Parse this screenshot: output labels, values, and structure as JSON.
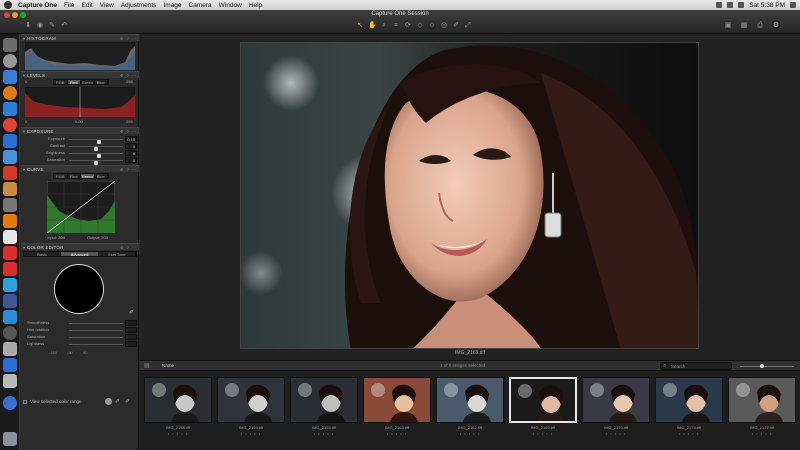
{
  "menubar": {
    "items": [
      "Capture One",
      "File",
      "Edit",
      "View",
      "Adjustments",
      "Image",
      "Camera",
      "Window",
      "Help"
    ],
    "clock": "Sat 5:38 PM"
  },
  "window": {
    "title": "Capture One Session"
  },
  "panel": {
    "histogram_title": "HISTOGRAM",
    "levels": {
      "title": "LEVELS",
      "channels": [
        "RGB",
        "Red",
        "Green",
        "Blue"
      ],
      "selected_channel": "Red",
      "low": "0",
      "mid": "0.00",
      "high": "255",
      "top_high": "255"
    },
    "exposure": {
      "title": "EXPOSURE",
      "rows": [
        {
          "label": "Exposure",
          "value": "0.15",
          "pos": 0.55
        },
        {
          "label": "Contrast",
          "value": "0",
          "pos": 0.5
        },
        {
          "label": "Brightness",
          "value": "8",
          "pos": 0.56
        },
        {
          "label": "Saturation",
          "value": "0",
          "pos": 0.5
        }
      ]
    },
    "curve": {
      "title": "CURVE",
      "channels": [
        "RGB",
        "Red",
        "Green",
        "Blue"
      ],
      "selected_channel": "Green",
      "input_label": "Input: 204",
      "output_label": "Output: 204"
    },
    "color_editor": {
      "title": "COLOR EDITOR",
      "modes": [
        "Basic",
        "Advanced",
        "Skin Tone"
      ],
      "selected_mode": "Advanced",
      "rows": [
        {
          "label": "Smoothness",
          "value": ""
        },
        {
          "label": "Hue rotation",
          "value": ""
        },
        {
          "label": "Saturation",
          "value": ""
        },
        {
          "label": "Lightness",
          "value": ""
        }
      ],
      "view_range_label": "View selected color range",
      "footer": [
        "-180",
        "-90",
        "90"
      ]
    }
  },
  "viewer": {
    "caption": "IMG_2169.tiff"
  },
  "browser": {
    "sort_label": "Name",
    "count_label": "1 of 9 images selected",
    "search_placeholder": "Search"
  },
  "thumbnails": [
    {
      "name": "IMG_2158.tiff",
      "selected": false
    },
    {
      "name": "IMG_2159.tiff",
      "selected": false
    },
    {
      "name": "IMG_2155.tiff",
      "selected": false
    },
    {
      "name": "IMG_2163.tiff",
      "selected": false
    },
    {
      "name": "IMG_2162.tiff",
      "selected": false
    },
    {
      "name": "IMG_2169.tiff",
      "selected": true
    },
    {
      "name": "IMG_2170.tiff",
      "selected": false
    },
    {
      "name": "IMG_2174.tiff",
      "selected": false
    },
    {
      "name": "IMG_2177.tiff",
      "selected": false
    }
  ],
  "colors": {
    "panel_bg": "#2b2b2b",
    "levels_red": "#8a2222",
    "curve_green": "#2f7a2f",
    "selection": "#e8e8e8"
  }
}
